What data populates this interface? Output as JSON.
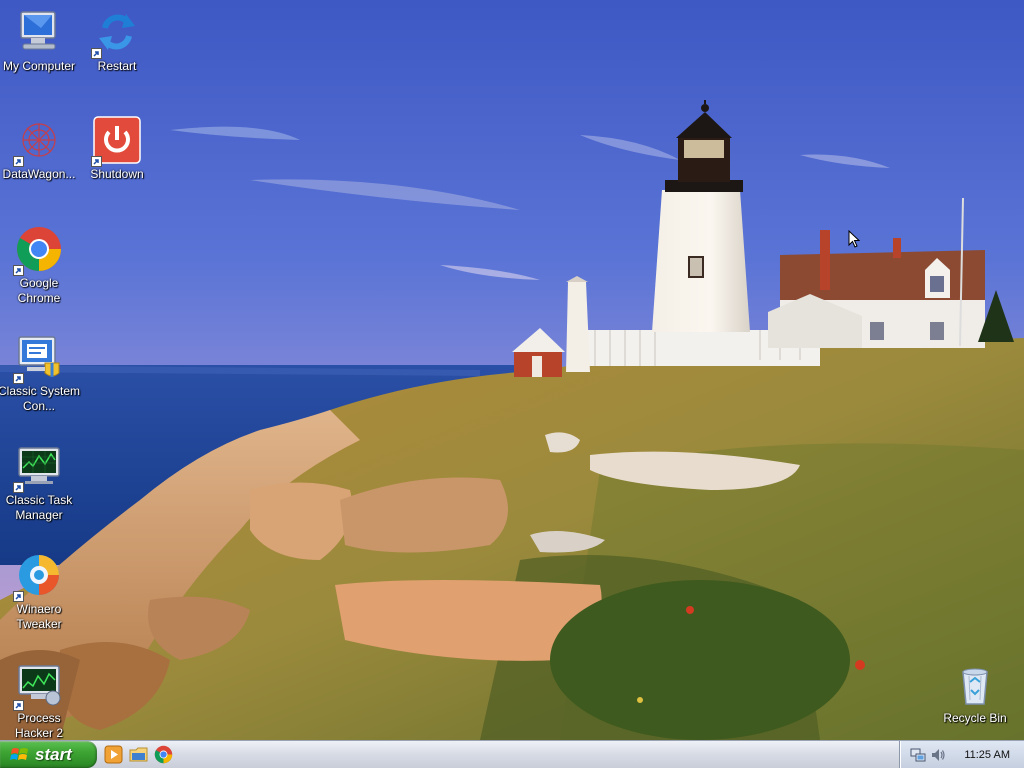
{
  "desktop": {
    "icons": [
      {
        "label": "My Computer",
        "shortcut": false,
        "icon": "computer-icon"
      },
      {
        "label": "Restart",
        "shortcut": true,
        "icon": "restart-icon"
      },
      {
        "label": "DataWagon...",
        "shortcut": true,
        "icon": "datawagon-icon"
      },
      {
        "label": "Shutdown",
        "shortcut": true,
        "icon": "shutdown-icon"
      },
      {
        "label": "Google Chrome",
        "shortcut": true,
        "icon": "chrome-icon"
      },
      {
        "label": "Classic System Con...",
        "shortcut": true,
        "icon": "control-panel-icon"
      },
      {
        "label": "Classic Task Manager",
        "shortcut": true,
        "icon": "task-manager-icon"
      },
      {
        "label": "Winaero Tweaker",
        "shortcut": true,
        "icon": "winaero-tweaker-icon"
      },
      {
        "label": "Process Hacker 2",
        "shortcut": true,
        "icon": "process-hacker-icon"
      },
      {
        "label": "Recycle Bin",
        "shortcut": false,
        "icon": "recycle-bin-icon"
      }
    ]
  },
  "taskbar": {
    "start_label": "start",
    "quick_launch": [
      "media-player-icon",
      "file-explorer-icon",
      "chrome-icon"
    ],
    "tray_icons": [
      "network-icon",
      "volume-icon"
    ],
    "clock": "11:25 AM"
  },
  "colors": {
    "start_green": "#3ea534",
    "taskbar_bg": "#d9dde6",
    "sky": "#4c6bd0"
  }
}
